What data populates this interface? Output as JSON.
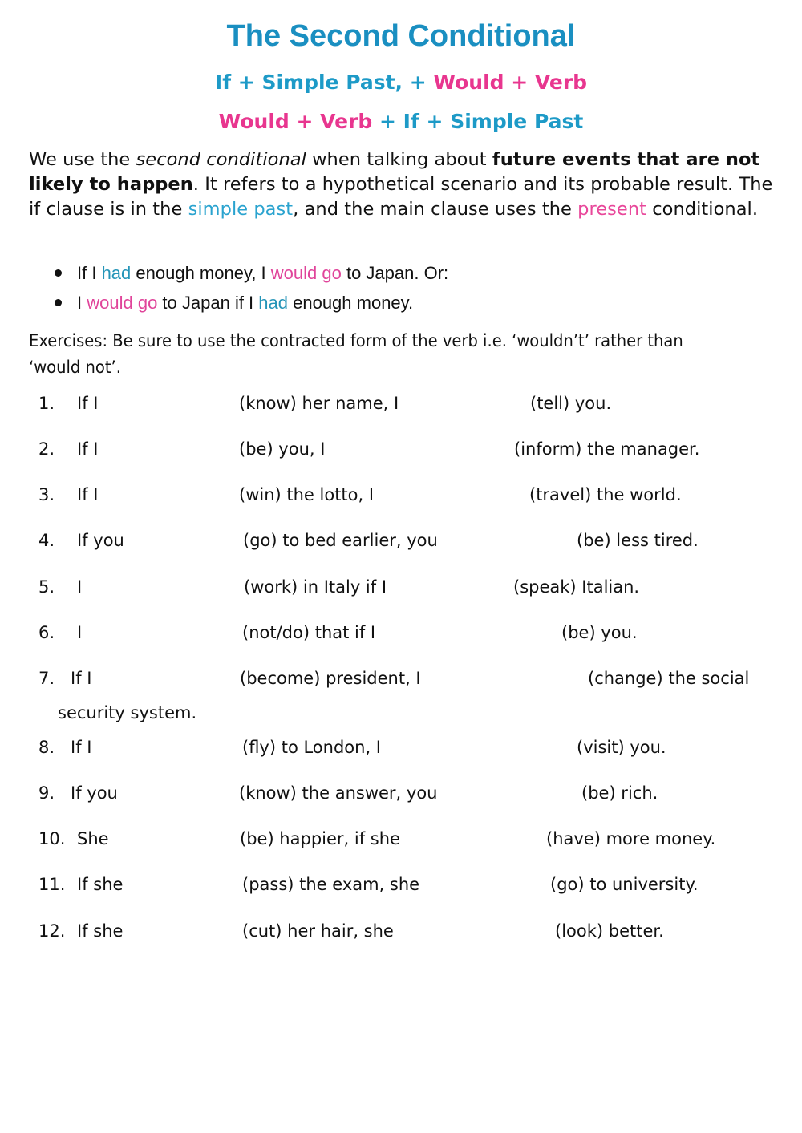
{
  "header": {
    "title": "The Second Conditional",
    "formula1": {
      "part_a": "If + Simple Past, + ",
      "part_b": "Would + Verb"
    },
    "formula2": {
      "part_a": "Would + Verb",
      "part_b": " + If + Simple Past"
    }
  },
  "intro": {
    "t1": "We use the ",
    "t2_italic": "second conditional",
    "t3": " when talking about ",
    "t4_bold": "future events that are not likely to happen",
    "t5": ". It refers to a hypothetical scenario and its probable result. The if clause is in the ",
    "t6_blue": "simple past",
    "t7": ", and the main clause uses the ",
    "t8_pink": "present",
    "t9": " conditional."
  },
  "examples": [
    {
      "a": "If I ",
      "b_blue": "had",
      "c": " enough money, I ",
      "d_pink": "would go",
      "e": " to Japan. Or:"
    },
    {
      "a": "I ",
      "b_pink": "would go",
      "c": " to Japan if I ",
      "d_blue": "had",
      "e": " enough money."
    }
  ],
  "instructions": "Exercises: Be sure to use the contracted form of the verb i.e. ‘wouldn’t’ rather than ‘would not’.",
  "exercises": [
    {
      "number": "1.",
      "start": "If I",
      "middle": "(know) her name, I",
      "end": "(tell) you.",
      "gap1": "",
      "gap2": ""
    },
    {
      "number": "2.",
      "start": "If I",
      "middle": "(be) you, I",
      "end": "(inform) the manager.",
      "gap1": "",
      "gap2": ""
    },
    {
      "number": "3.",
      "start": "If I",
      "middle": "(win) the lotto, I",
      "end": "(travel) the world.",
      "gap1": "",
      "gap2": ""
    },
    {
      "number": "4.",
      "start": "If you",
      "middle": "(go) to bed earlier, you",
      "end": "(be) less tired.",
      "gap1": "",
      "gap2": ""
    },
    {
      "number": "5.",
      "start": "I",
      "middle": "(work) in Italy if I",
      "end": "(speak) Italian.",
      "gap1": "",
      "gap2": ""
    },
    {
      "number": "6.",
      "start": "I",
      "middle": "(not/do) that if I",
      "end": "(be) you.",
      "gap1": "",
      "gap2": ""
    },
    {
      "number": "7.",
      "start": "If I",
      "middle": "(become) president, I",
      "end": "(change) the social",
      "continuation": "security system.",
      "gap1": "",
      "gap2": ""
    },
    {
      "number": "8.",
      "start": "If I",
      "middle": "(fly) to London, I",
      "end": "(visit) you.",
      "gap1": "",
      "gap2": ""
    },
    {
      "number": "9.",
      "start": "If you",
      "middle": "(know) the answer, you",
      "end": "(be) rich.",
      "gap1": "",
      "gap2": ""
    },
    {
      "number": "10.",
      "start": "She",
      "middle": "(be) happier, if she",
      "end": "(have) more money.",
      "gap1": "",
      "gap2": ""
    },
    {
      "number": "11.",
      "start": "If she",
      "middle": "(pass) the exam, she",
      "end": "(go) to university.",
      "gap1": "",
      "gap2": ""
    },
    {
      "number": "12.",
      "start": "If she",
      "middle": "(cut) her hair, she",
      "end": "(look) better.",
      "gap1": "",
      "gap2": ""
    }
  ],
  "colors": {
    "title_blue": "#1a8fc1",
    "formula_blue": "#1d9ac7",
    "accent_pink": "#e8368f",
    "text": "#111111"
  }
}
